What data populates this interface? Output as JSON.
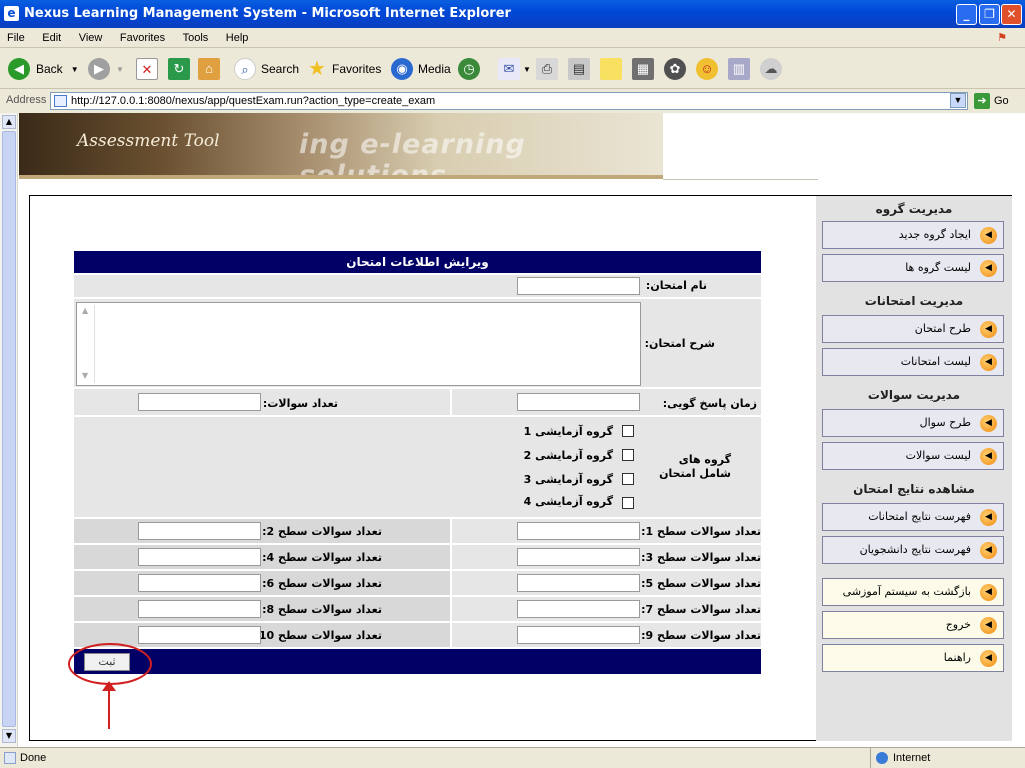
{
  "window": {
    "title": "Nexus Learning Management System - Microsoft Internet Explorer"
  },
  "menubar": [
    "File",
    "Edit",
    "View",
    "Favorites",
    "Tools",
    "Help"
  ],
  "toolbar": {
    "back": "Back",
    "search": "Search",
    "favorites": "Favorites",
    "media": "Media"
  },
  "address": {
    "label": "Address",
    "url": "http://127.0.0.1:8080/nexus/app/questExam.run?action_type=create_exam",
    "go": "Go"
  },
  "banner": {
    "subtitle": "Assessment Tool",
    "slogan": "ing e-learning solutions"
  },
  "sidebar": {
    "sections": [
      {
        "title": "مدیریت گروه",
        "items": [
          "ایجاد گروه جدید",
          "لیست گروه ها"
        ]
      },
      {
        "title": "مدیریت امتحانات",
        "items": [
          "طرح امتحان",
          "لیست امتحانات"
        ]
      },
      {
        "title": "مدیریت سوالات",
        "items": [
          "طرح سوال",
          "لیست سوالات"
        ]
      },
      {
        "title": "مشاهده نتایج امتحان",
        "items": [
          "فهرست نتایج امتحانات",
          "فهرست نتایج دانشجویان"
        ]
      }
    ],
    "extra": [
      "بازگشت به سیستم آموزشی",
      "خروج",
      "راهنما"
    ]
  },
  "form": {
    "title": "ویرایش اطلاعات امتحان",
    "exam_name_label": "نام امتحان:",
    "exam_desc_label": "شرح امتحان:",
    "response_time_label": "زمان پاسخ گویی:",
    "question_count_label": "تعداد سوالات:",
    "groups_label": "گروه های شامل امتحان",
    "groups": [
      "گروه آزمایشی 1",
      "گروه آزمایشی 2",
      "گروه آزمایشی 3",
      "گروه آزمایشی 4"
    ],
    "levels": [
      "تعداد سوالات سطح 1:",
      "تعداد سوالات سطح 2:",
      "تعداد سوالات سطح 3:",
      "تعداد سوالات سطح 4:",
      "تعداد سوالات سطح 5:",
      "تعداد سوالات سطح 6:",
      "تعداد سوالات سطح 7:",
      "تعداد سوالات سطح 8:",
      "تعداد سوالات سطح 9:",
      "تعداد سوالات سطح 10:"
    ],
    "submit": "ثبت"
  },
  "status": {
    "text": "Done",
    "zone": "Internet"
  }
}
